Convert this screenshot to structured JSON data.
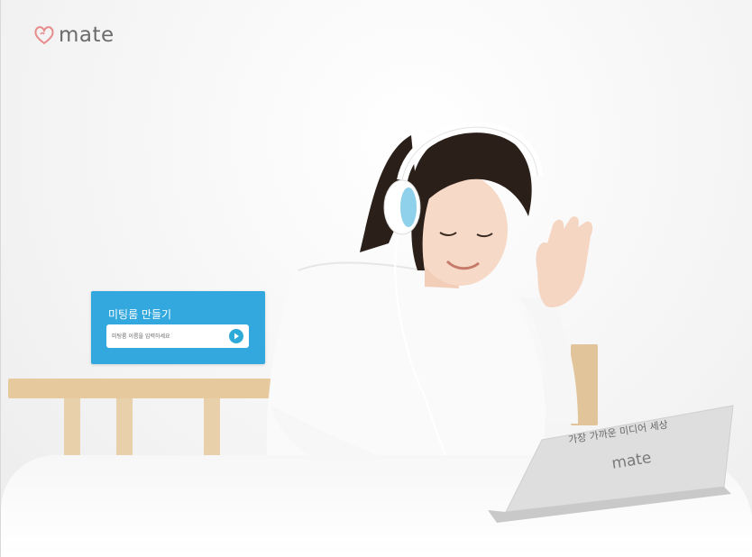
{
  "brand": {
    "logo_text": "mate",
    "logo_color": "#e88a8a"
  },
  "meeting_card": {
    "title": "미팅룸 만들기",
    "input_placeholder": "미팅룸 이름을 입력하세요",
    "input_value": "",
    "go_icon": "play-circle-icon",
    "accent": "#33a8de"
  },
  "laptop": {
    "tagline": "가장 가까운 미디어 세상",
    "logo_text": "mate"
  },
  "colors": {
    "card_bg": "#33a8de",
    "headboard": "#e6c99d"
  }
}
